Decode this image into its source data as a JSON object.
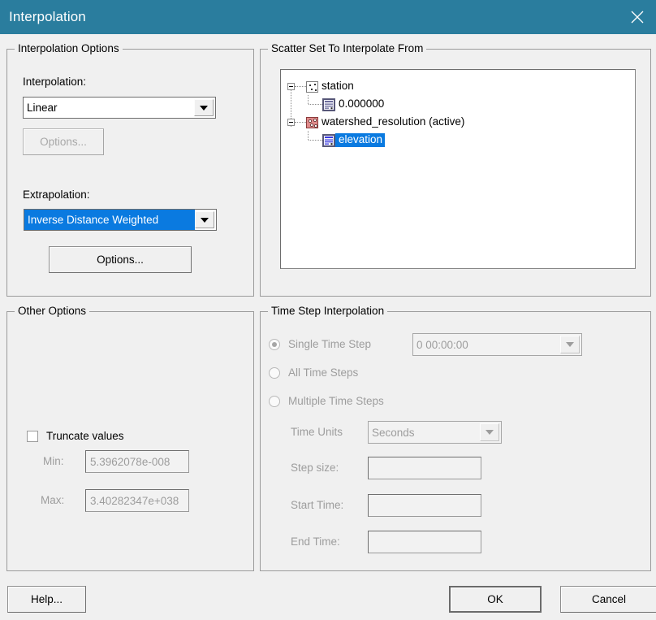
{
  "window": {
    "title": "Interpolation",
    "titlebar_color": "#2a7d9e",
    "close_icon": "close-icon"
  },
  "interpolation_options": {
    "group_label": "Interpolation Options",
    "interpolation_label": "Interpolation:",
    "interpolation_value": "Linear",
    "interpolation_options_button": "Options...",
    "interpolation_options_button_enabled": false,
    "extrapolation_label": "Extrapolation:",
    "extrapolation_value": "Inverse Distance Weighted",
    "extrapolation_value_selected": true,
    "extrapolation_options_button": "Options...",
    "selection_color": "#0a7ae0"
  },
  "scatter_set": {
    "group_label": "Scatter Set To Interpolate From",
    "tree": [
      {
        "label": "station",
        "icon": "scatter-set-icon",
        "expanded": true,
        "active": false,
        "children": [
          {
            "label": "0.000000",
            "icon": "dataset-icon",
            "selected": false
          }
        ]
      },
      {
        "label": "watershed_resolution (active)",
        "icon": "scatter-set-active-icon",
        "expanded": true,
        "active": true,
        "children": [
          {
            "label": "elevation",
            "icon": "dataset-icon",
            "selected": true
          }
        ]
      }
    ]
  },
  "other_options": {
    "group_label": "Other Options",
    "truncate_label": "Truncate values",
    "truncate_checked": false,
    "min_label": "Min:",
    "min_value": "5.3962078e-008",
    "max_label": "Max:",
    "max_value": "3.40282347e+038",
    "fields_enabled": false
  },
  "time_step": {
    "group_label": "Time Step Interpolation",
    "single_time_step_label": "Single Time Step",
    "single_time_step_checked": true,
    "single_time_step_value": "0 00:00:00",
    "all_time_steps_label": "All Time Steps",
    "all_time_steps_checked": false,
    "multiple_time_steps_label": "Multiple Time Steps",
    "multiple_time_steps_checked": false,
    "time_units_label": "Time Units",
    "time_units_value": "Seconds",
    "step_size_label": "Step size:",
    "step_size_value": "",
    "start_time_label": "Start Time:",
    "start_time_value": "",
    "end_time_label": "End Time:",
    "end_time_value": "",
    "enabled": false
  },
  "footer": {
    "help_label": "Help...",
    "ok_label": "OK",
    "cancel_label": "Cancel"
  }
}
